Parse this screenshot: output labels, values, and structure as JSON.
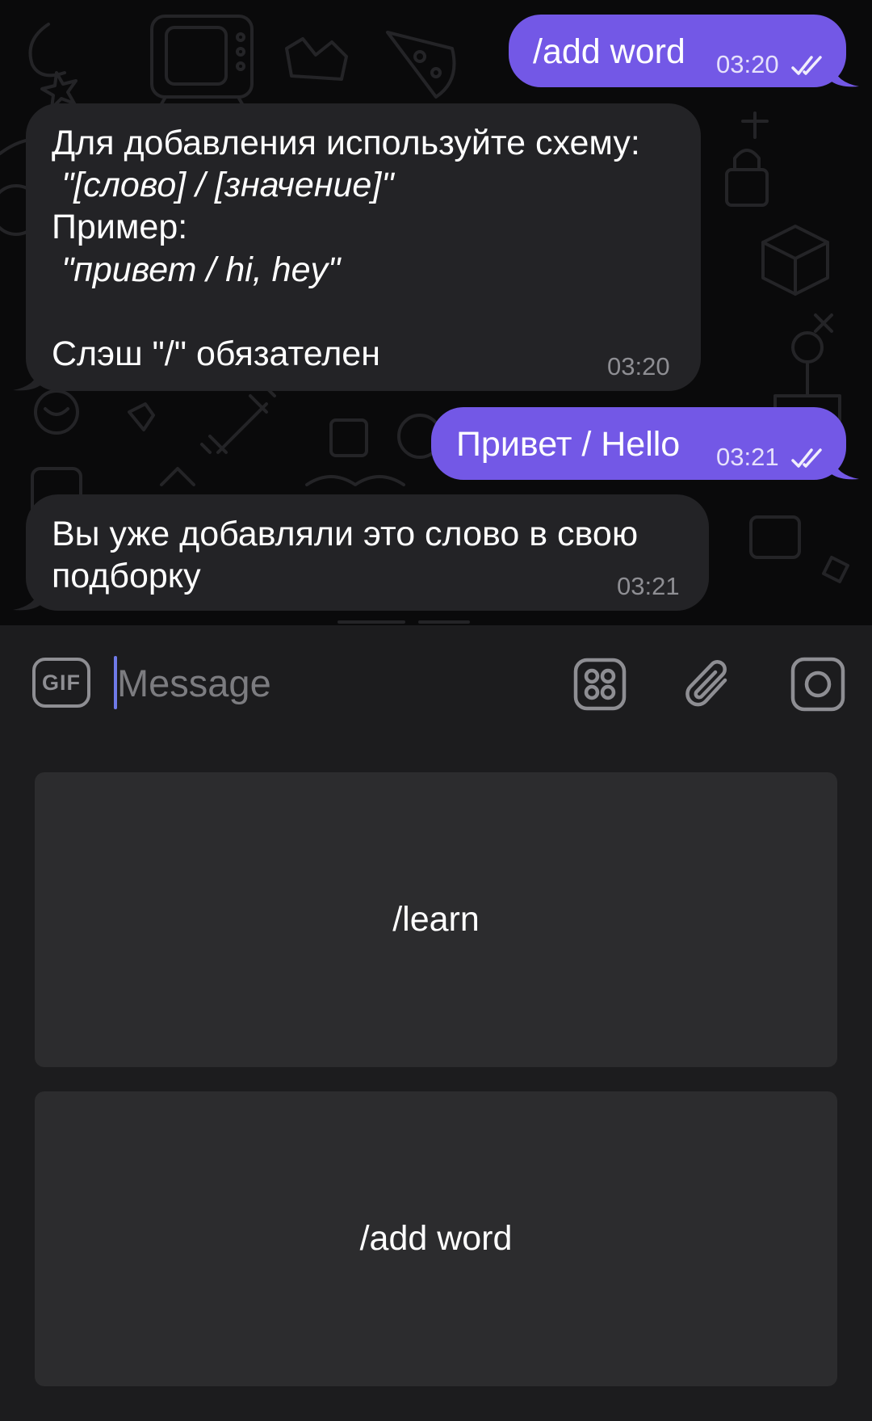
{
  "messages": [
    {
      "direction": "outgoing",
      "text": "/add word",
      "time": "03:20",
      "status": "read"
    },
    {
      "direction": "incoming",
      "lines": [
        {
          "text": "Для добавления используйте схему:",
          "italic": false
        },
        {
          "text": " \"[слово] / [значение]\"",
          "italic": true
        },
        {
          "text": "Пример:",
          "italic": false
        },
        {
          "text": " \"привет / hi, hey\"",
          "italic": true
        },
        {
          "text": "",
          "italic": false
        },
        {
          "text": "Слэш \"/\" обязателен",
          "italic": false
        }
      ],
      "time": "03:20"
    },
    {
      "direction": "outgoing",
      "text": "Привет / Hello",
      "time": "03:21",
      "status": "read"
    },
    {
      "direction": "incoming",
      "lines": [
        {
          "text": "Вы уже добавляли это слово в свою",
          "italic": false
        },
        {
          "text": "подборку",
          "italic": false
        }
      ],
      "time": "03:21"
    }
  ],
  "input": {
    "gif_label": "GIF",
    "placeholder": "Message",
    "value": "",
    "icons": [
      "sticker-grid-icon",
      "paperclip-icon",
      "camera-icon"
    ]
  },
  "keyboard": {
    "buttons": [
      {
        "label": "/learn"
      },
      {
        "label": "/add word"
      }
    ]
  },
  "colors": {
    "outgoing_bubble": "#7358e6",
    "incoming_bubble": "#232326",
    "chat_background": "#0a0a0b",
    "panel_background": "#1c1c1e",
    "keyboard_button": "#2c2c2e",
    "caret": "#6f7ae8"
  }
}
